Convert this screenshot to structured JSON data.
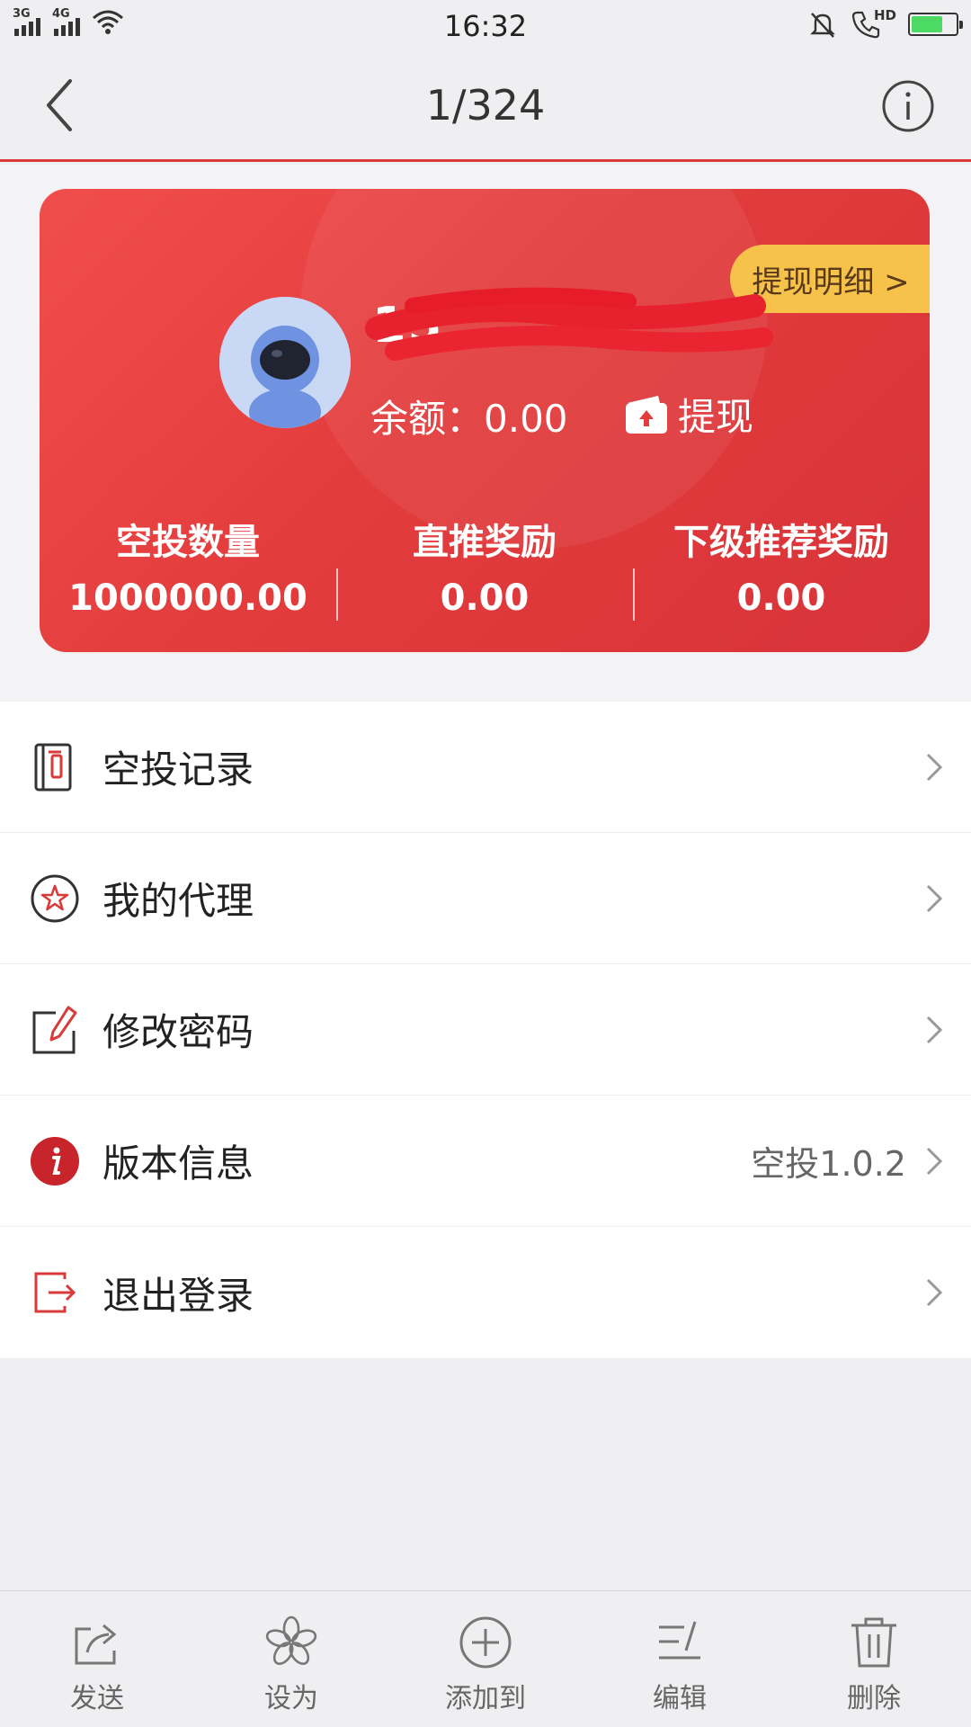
{
  "status_bar": {
    "signal1_label": "3G",
    "signal2_label": "4G",
    "time": "16:32",
    "call_label": "HD"
  },
  "nav": {
    "title": "1/324"
  },
  "card": {
    "detail_tag": "提现明细 >",
    "username": "15",
    "balance": "余额：0.00",
    "withdraw_label": "提现",
    "stats": [
      {
        "label": "空投数量",
        "value": "1000000.00"
      },
      {
        "label": "直推奖励",
        "value": "0.00"
      },
      {
        "label": "下级推荐奖励",
        "value": "0.00"
      }
    ]
  },
  "menu": [
    {
      "label": "空投记录",
      "icon": "record-book-icon",
      "extra": ""
    },
    {
      "label": "我的代理",
      "icon": "star-circle-icon",
      "extra": ""
    },
    {
      "label": "修改密码",
      "icon": "edit-pen-icon",
      "extra": ""
    },
    {
      "label": "版本信息",
      "icon": "info-circle-icon",
      "extra": "空投1.0.2"
    },
    {
      "label": "退出登录",
      "icon": "logout-icon",
      "extra": ""
    }
  ],
  "toolbar": [
    {
      "label": "发送",
      "icon": "share-icon"
    },
    {
      "label": "设为",
      "icon": "flower-icon"
    },
    {
      "label": "添加到",
      "icon": "plus-circle-icon"
    },
    {
      "label": "编辑",
      "icon": "edit-lines-icon"
    },
    {
      "label": "删除",
      "icon": "trash-icon"
    }
  ],
  "colors": {
    "accent_red": "#e33c3c",
    "tag_yellow": "#f7c24a",
    "background": "#efeff1"
  }
}
